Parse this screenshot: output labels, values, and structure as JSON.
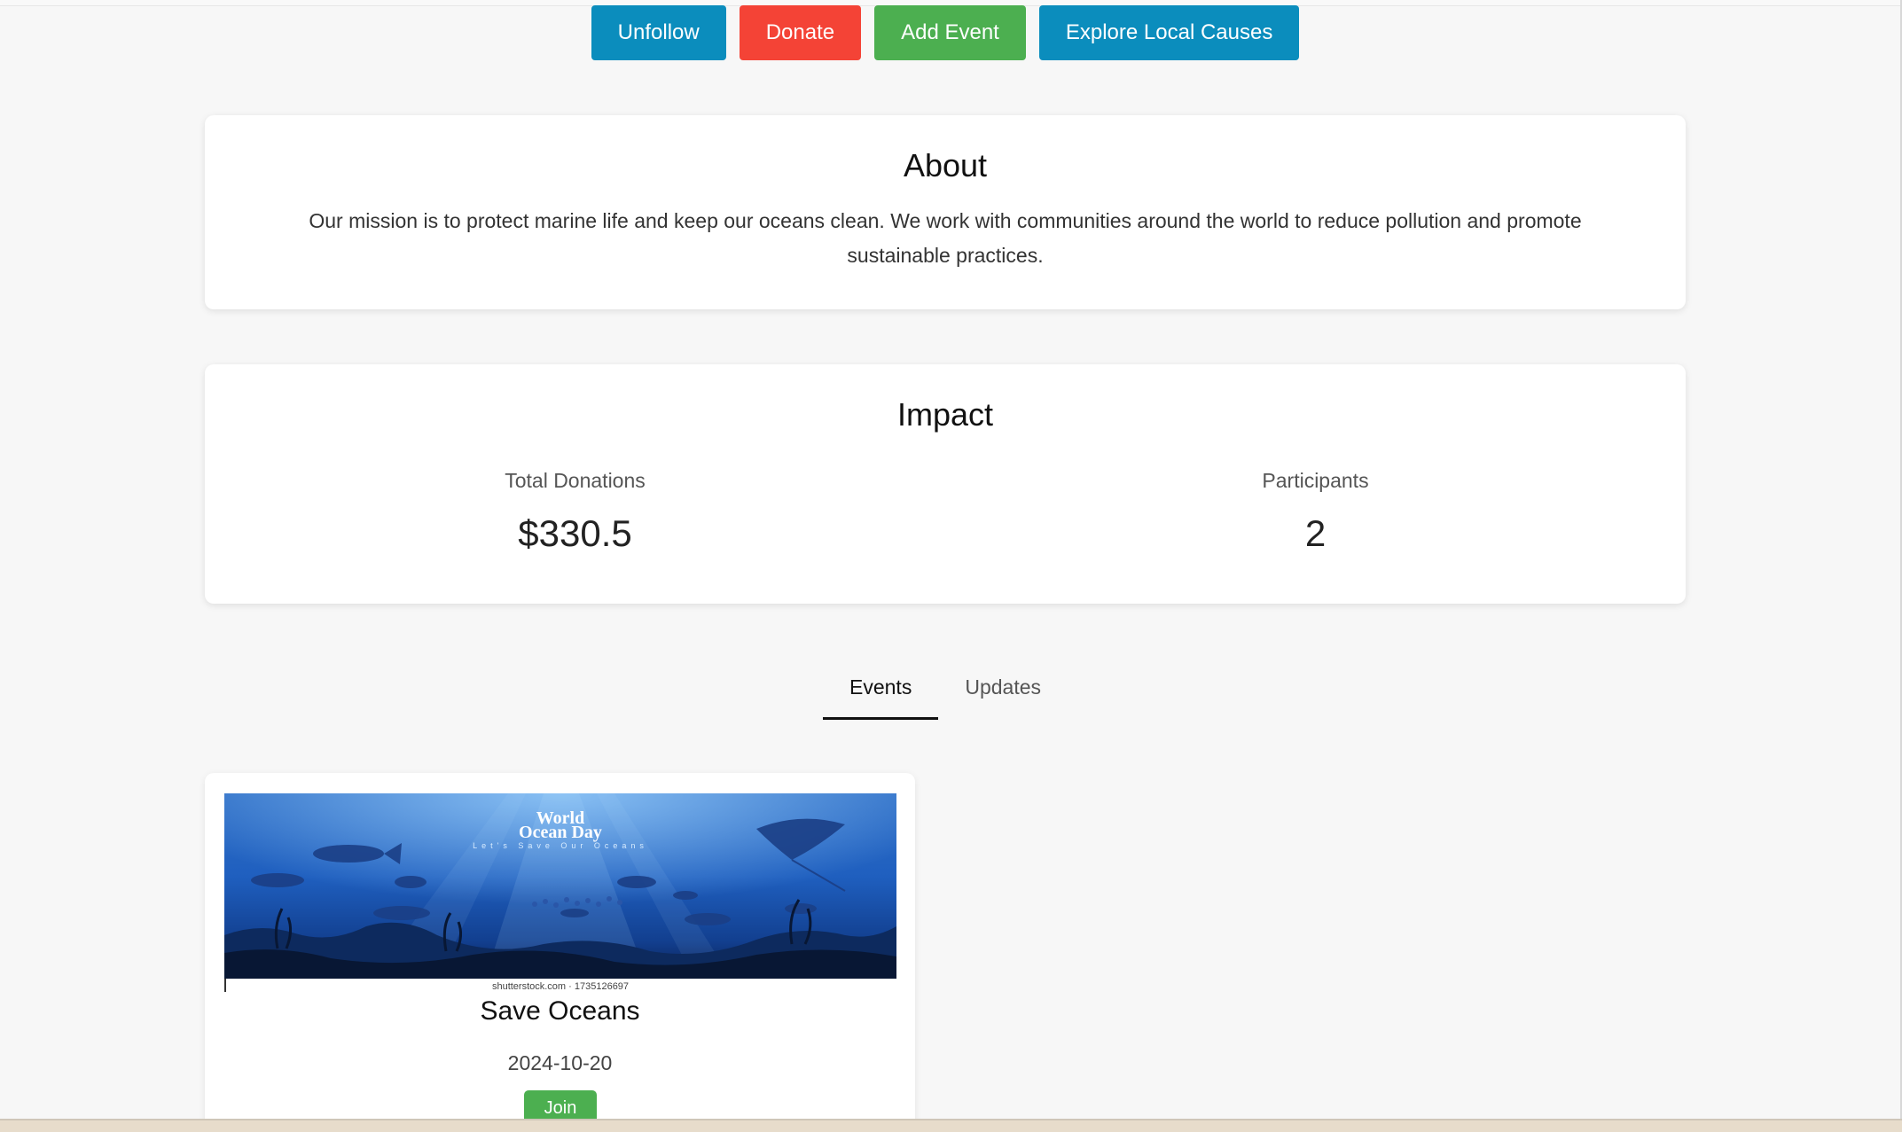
{
  "actions": {
    "unfollow": "Unfollow",
    "donate": "Donate",
    "add_event": "Add Event",
    "explore": "Explore Local Causes"
  },
  "about": {
    "title": "About",
    "text": "Our mission is to protect marine life and keep our oceans clean. We work with communities around the world to reduce pollution and promote sustainable practices."
  },
  "impact": {
    "title": "Impact",
    "donations_label": "Total Donations",
    "donations_value": "$330.5",
    "participants_label": "Participants",
    "participants_value": "2"
  },
  "tabs": {
    "events": "Events",
    "updates": "Updates",
    "active": "Events"
  },
  "event": {
    "image_title_line1": "World",
    "image_title_line2": "Ocean Day",
    "image_subtitle": "Let's Save Our Oceans",
    "image_watermark": "shutterstock.com · 1735126697",
    "title": "Save Oceans",
    "date": "2024-10-20",
    "join_label": "Join"
  },
  "colors": {
    "blue": "#0b8dbd",
    "red": "#f44336",
    "green": "#4caf50"
  }
}
